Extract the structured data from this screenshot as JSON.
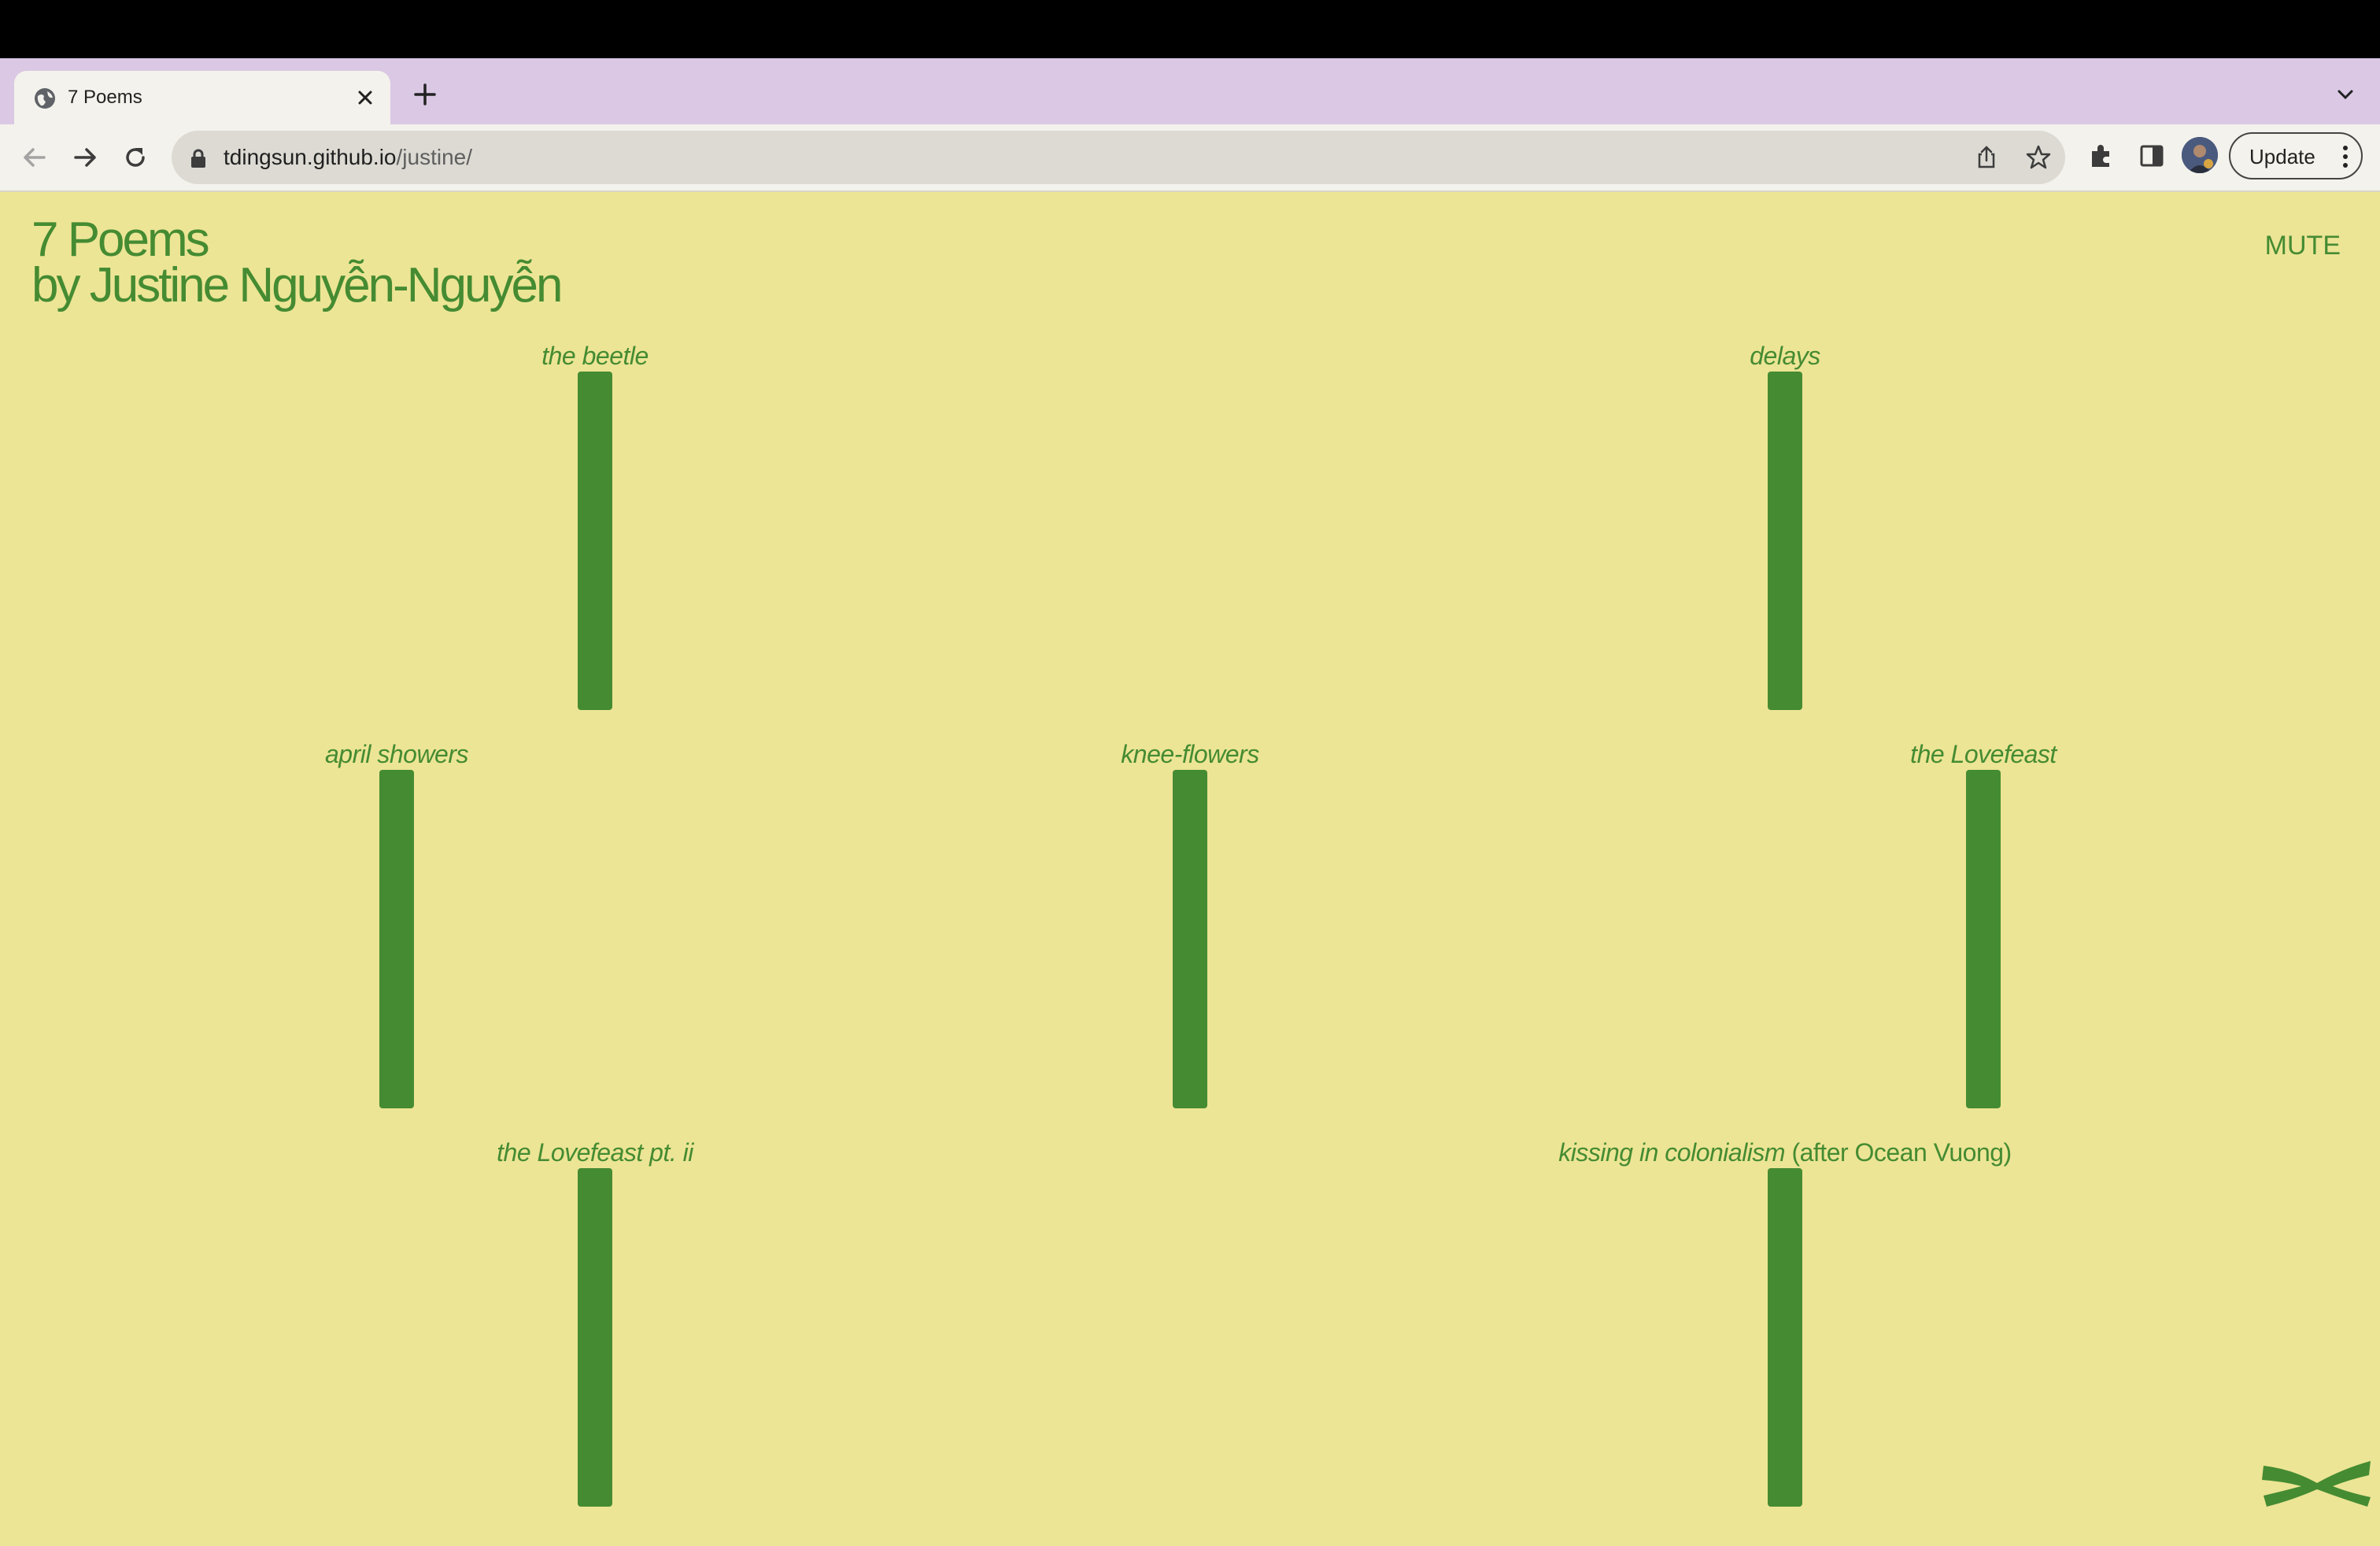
{
  "browser": {
    "tab": {
      "title": "7 Poems",
      "favicon": "globe-icon",
      "close": "close-icon"
    },
    "new_tab": "plus-icon",
    "tab_list": "chevron-down-icon",
    "nav": {
      "back": "back-arrow-icon",
      "forward": "forward-arrow-icon",
      "reload": "reload-icon"
    },
    "url": {
      "host": "tdingsun.github.io",
      "path": "/justine/"
    },
    "update_label": "Update"
  },
  "page": {
    "title_line1": "7 Poems",
    "title_line2": "by Justine Nguyễn-Nguyễn",
    "mute_label": "MUTE",
    "poems": [
      {
        "title": "the beetle",
        "tail": ""
      },
      {
        "title": "delays",
        "tail": ""
      },
      {
        "title": "april showers",
        "tail": ""
      },
      {
        "title": "knee-flowers",
        "tail": ""
      },
      {
        "title": "the Lovefeast",
        "tail": ""
      },
      {
        "title": "the Lovefeast pt. ii",
        "tail": ""
      },
      {
        "title": "kissing in colonialism",
        "tail": " (after Ocean Vuong)"
      }
    ]
  },
  "colors": {
    "page_bg": "#ece595",
    "accent_green": "#458b32",
    "tab_strip": "#dac8e4"
  }
}
